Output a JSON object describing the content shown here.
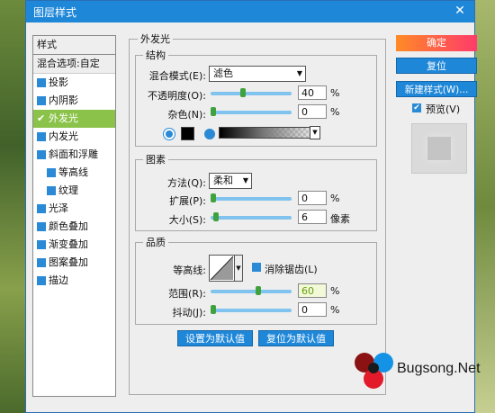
{
  "window": {
    "title": "图层样式",
    "close_icon": "close-icon"
  },
  "styles_list": {
    "header": "样式",
    "blend_label": "混合选项:自定",
    "items": [
      {
        "label": "投影",
        "checked": false,
        "sub": false
      },
      {
        "label": "内阴影",
        "checked": false,
        "sub": false
      },
      {
        "label": "外发光",
        "checked": true,
        "sub": false,
        "selected": true
      },
      {
        "label": "内发光",
        "checked": false,
        "sub": false
      },
      {
        "label": "斜面和浮雕",
        "checked": false,
        "sub": false
      },
      {
        "label": "等高线",
        "checked": false,
        "sub": true
      },
      {
        "label": "纹理",
        "checked": false,
        "sub": true
      },
      {
        "label": "光泽",
        "checked": false,
        "sub": false
      },
      {
        "label": "颜色叠加",
        "checked": false,
        "sub": false
      },
      {
        "label": "渐变叠加",
        "checked": false,
        "sub": false
      },
      {
        "label": "图案叠加",
        "checked": false,
        "sub": false
      },
      {
        "label": "描边",
        "checked": false,
        "sub": false
      }
    ]
  },
  "panel": {
    "title": "外发光",
    "structure": {
      "title": "结构",
      "blend_mode_label": "混合模式(E):",
      "blend_mode_value": "滤色",
      "opacity_label": "不透明度(O):",
      "opacity_value": "40",
      "opacity_unit": "%",
      "noise_label": "杂色(N):",
      "noise_value": "0",
      "noise_unit": "%"
    },
    "elements": {
      "title": "图素",
      "technique_label": "方法(Q):",
      "technique_value": "柔和",
      "spread_label": "扩展(P):",
      "spread_value": "0",
      "spread_unit": "%",
      "size_label": "大小(S):",
      "size_value": "6",
      "size_unit": "像素"
    },
    "quality": {
      "title": "品质",
      "contour_label": "等高线:",
      "antialias_label": "消除锯齿(L)",
      "range_label": "范围(R):",
      "range_value": "60",
      "range_unit": "%",
      "jitter_label": "抖动(J):",
      "jitter_value": "0",
      "jitter_unit": "%"
    },
    "set_default_label": "设置为默认值",
    "reset_default_label": "复位为默认值"
  },
  "actions": {
    "ok_label": "确定",
    "reset_label": "复位",
    "new_style_label": "新建样式(W)...",
    "preview_label": "预览(V)",
    "preview_checked": true
  },
  "watermark": {
    "text": "Bugsong.Net"
  },
  "colors": {
    "accent": "#1f87d8",
    "selected": "#8bc34a",
    "ok_gradient_start": "#ff8a26",
    "ok_gradient_end": "#ff3b6b"
  }
}
